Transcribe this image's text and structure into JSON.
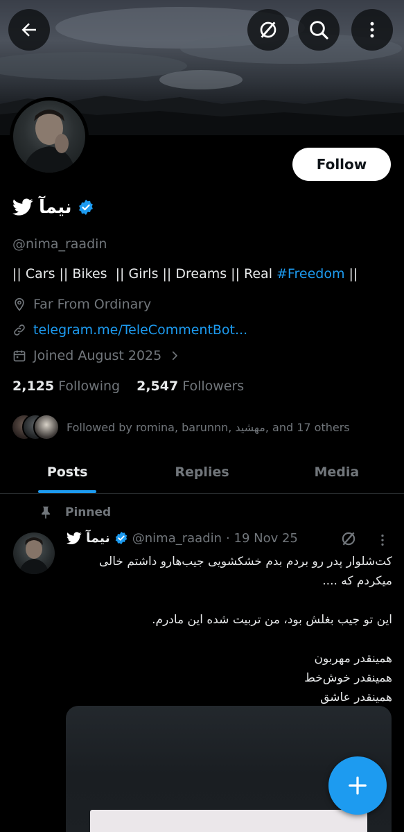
{
  "top_bar": {
    "back_icon": "arrow-left-icon",
    "grok_icon": "grok-icon",
    "search_icon": "search-icon",
    "more_icon": "more-vertical-icon"
  },
  "profile": {
    "follow_label": "Follow",
    "display_name": "نیمآ",
    "handle": "@nima_raadin",
    "bio_text": "|| Cars || Bikes  || Girls || Dreams || Real ",
    "bio_hashtag": "#Freedom",
    "bio_end": " ||",
    "location": "Far From Ordinary",
    "website": "telegram.me/TeleCommentBot...",
    "joined": "Joined August 2025",
    "following_count": "2,125",
    "following_label": "Following",
    "followers_count": "2,547",
    "followers_label": "Followers",
    "followed_by": "Followed by romina, barunnn, مهشید, and 17 others",
    "verified_color": "#1d9bf0"
  },
  "tabs": [
    {
      "label": "Posts",
      "active": true
    },
    {
      "label": "Replies",
      "active": false
    },
    {
      "label": "Media",
      "active": false
    }
  ],
  "post": {
    "pinned_label": "Pinned",
    "display_name": "نیمآ",
    "handle": "@nima_raadin",
    "date": "· 19 Nov 25",
    "lines": [
      "کت‌شلوار پدر رو بردم بدم خشکشویی جیب‌هارو داشتم خالی میکردم که ....",
      "",
      "این تو جیب بغلش بود، من تربیت شده این مادرم.",
      "",
      "همینقدر مهربون",
      "همینقدر خوش‌خط",
      "همینقدر عاشق"
    ]
  },
  "fab": {
    "icon": "plus-icon"
  },
  "colors": {
    "accent": "#1d9bf0",
    "background": "#000000",
    "muted": "#71767b"
  }
}
